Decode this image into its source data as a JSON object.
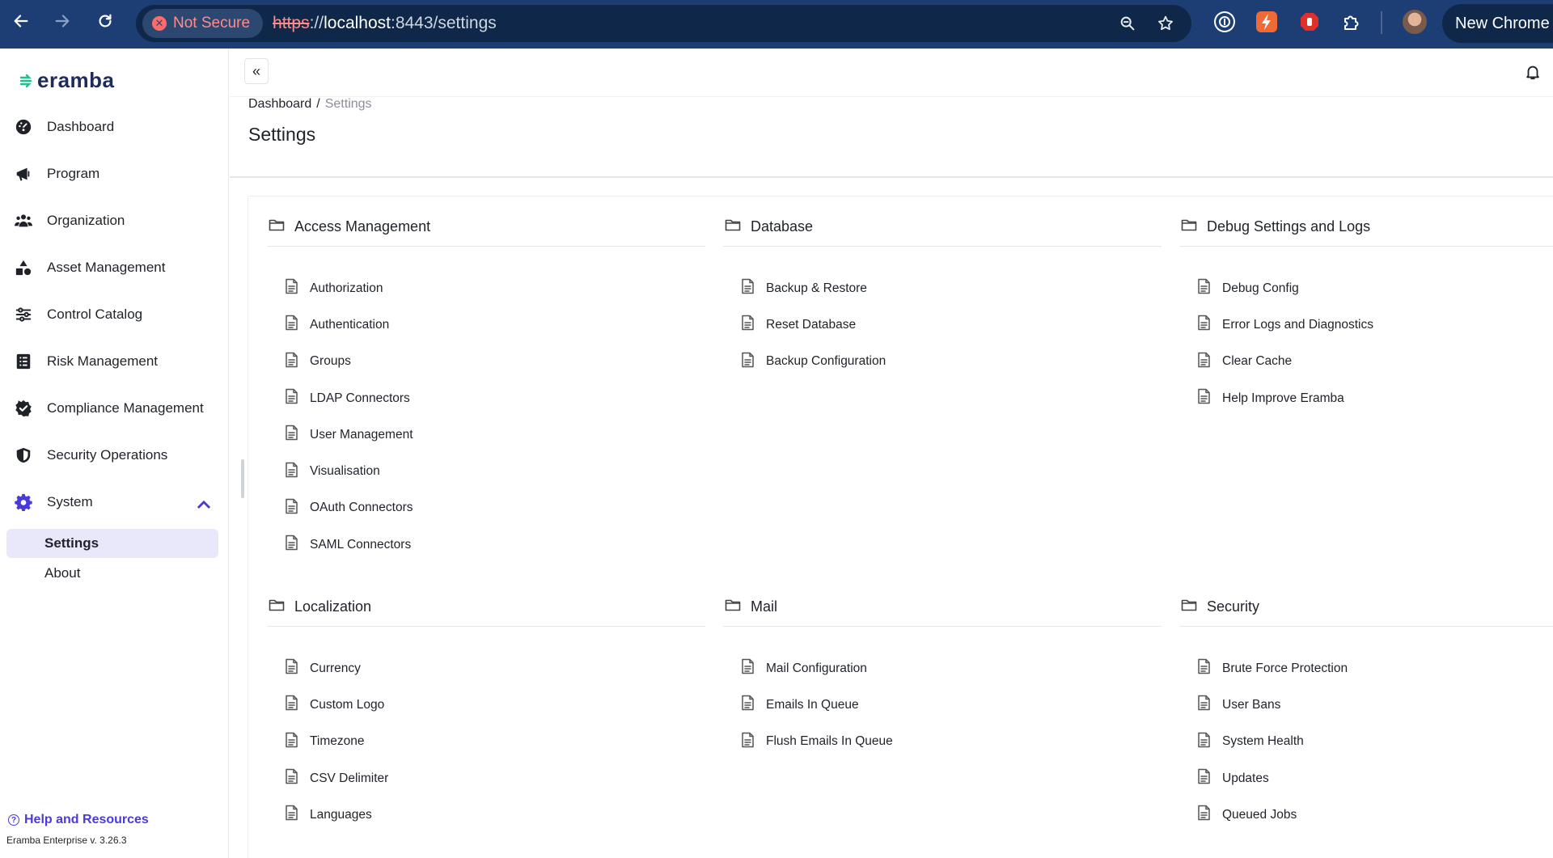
{
  "browser": {
    "not_secure_label": "Not Secure",
    "url_scheme": "https",
    "url_sep": "://",
    "url_host": "localhost",
    "url_rest": ":8443/settings",
    "new_chrome_label": "New Chrome"
  },
  "sidebar": {
    "logo_text": "eramba",
    "items": [
      {
        "label": "Dashboard",
        "icon": "gauge-icon"
      },
      {
        "label": "Program",
        "icon": "megaphone-icon"
      },
      {
        "label": "Organization",
        "icon": "users-icon"
      },
      {
        "label": "Asset Management",
        "icon": "shapes-icon"
      },
      {
        "label": "Control Catalog",
        "icon": "sliders-icon"
      },
      {
        "label": "Risk Management",
        "icon": "list-icon"
      },
      {
        "label": "Compliance Management",
        "icon": "check-badge-icon"
      },
      {
        "label": "Security Operations",
        "icon": "shield-icon"
      },
      {
        "label": "System",
        "icon": "gear-icon"
      }
    ],
    "sub_items": [
      {
        "label": "Settings",
        "active": true
      },
      {
        "label": "About",
        "active": false
      }
    ],
    "help_label": "Help and Resources",
    "version": "Eramba Enterprise v. 3.26.3",
    "accent_color": "#4b3bd6"
  },
  "breadcrumb": {
    "root": "Dashboard",
    "separator": "/",
    "current": "Settings"
  },
  "page_title": "Settings",
  "sections": [
    {
      "title": "Access Management",
      "links": [
        "Authorization",
        "Authentication",
        "Groups",
        "LDAP Connectors",
        "User Management",
        "Visualisation",
        "OAuth Connectors",
        "SAML Connectors"
      ]
    },
    {
      "title": "Database",
      "links": [
        "Backup & Restore",
        "Reset Database",
        "Backup Configuration"
      ]
    },
    {
      "title": "Debug Settings and Logs",
      "links": [
        "Debug Config",
        "Error Logs and Diagnostics",
        "Clear Cache",
        "Help Improve Eramba"
      ]
    },
    {
      "title": "Localization",
      "links": [
        "Currency",
        "Custom Logo",
        "Timezone",
        "CSV Delimiter",
        "Languages"
      ]
    },
    {
      "title": "Mail",
      "links": [
        "Mail Configuration",
        "Emails In Queue",
        "Flush Emails In Queue"
      ]
    },
    {
      "title": "Security",
      "links": [
        "Brute Force Protection",
        "User Bans",
        "System Health",
        "Updates",
        "Queued Jobs"
      ]
    }
  ]
}
